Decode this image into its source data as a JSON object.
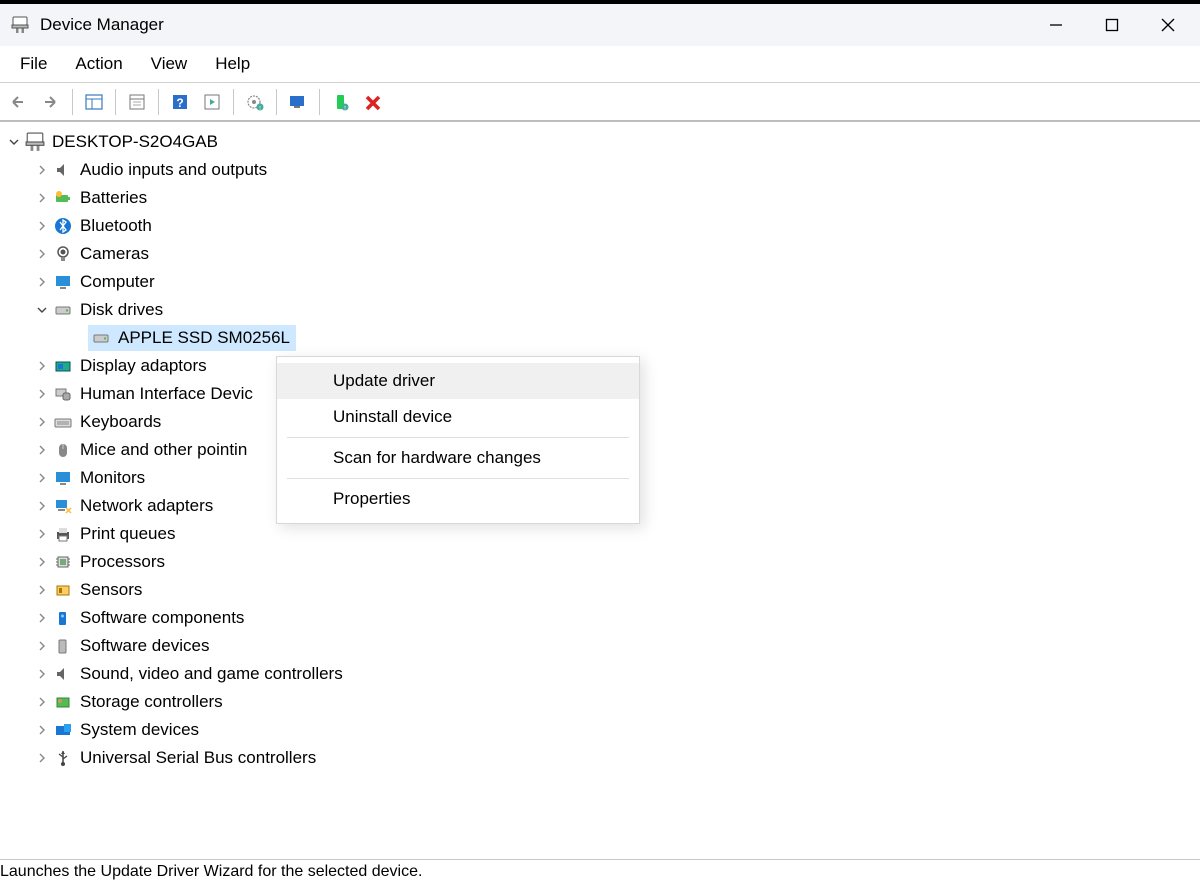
{
  "window": {
    "title": "Device Manager"
  },
  "menu": {
    "file": "File",
    "action": "Action",
    "view": "View",
    "help": "Help"
  },
  "tree": {
    "root": "DESKTOP-S2O4GAB",
    "categories": {
      "audio": "Audio inputs and outputs",
      "batteries": "Batteries",
      "bluetooth": "Bluetooth",
      "cameras": "Cameras",
      "computer": "Computer",
      "disk": "Disk drives",
      "display": "Display adaptors",
      "hid": "Human Interface Devic",
      "keyboards": "Keyboards",
      "mice": "Mice and other pointin",
      "monitors": "Monitors",
      "network": "Network adapters",
      "print": "Print queues",
      "processors": "Processors",
      "sensors": "Sensors",
      "swcomp": "Software components",
      "swdev": "Software devices",
      "sound": "Sound, video and game controllers",
      "storage": "Storage controllers",
      "system": "System devices",
      "usb": "Universal Serial Bus controllers"
    },
    "selected_device": "APPLE SSD SM0256L"
  },
  "context_menu": {
    "update": "Update driver",
    "uninstall": "Uninstall device",
    "scan": "Scan for hardware changes",
    "properties": "Properties"
  },
  "statusbar": "Launches the Update Driver Wizard for the selected device."
}
